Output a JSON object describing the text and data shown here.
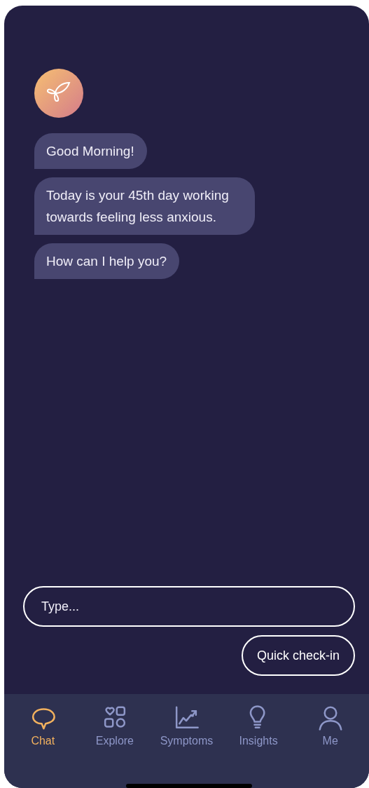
{
  "messages": [
    {
      "text": "Good Morning!"
    },
    {
      "text": "Today is your 45th day working towards feeling less anxious."
    },
    {
      "text": "How can I help you?"
    }
  ],
  "input": {
    "placeholder": "Type..."
  },
  "quick_action": "Quick check-in",
  "tabs": [
    {
      "label": "Chat",
      "kind": "chat",
      "selected": true
    },
    {
      "label": "Explore",
      "kind": "explore",
      "selected": false
    },
    {
      "label": "Symptoms",
      "kind": "symptoms",
      "selected": false
    },
    {
      "label": "Insights",
      "kind": "insights",
      "selected": false
    },
    {
      "label": "Me",
      "kind": "me",
      "selected": false
    }
  ]
}
